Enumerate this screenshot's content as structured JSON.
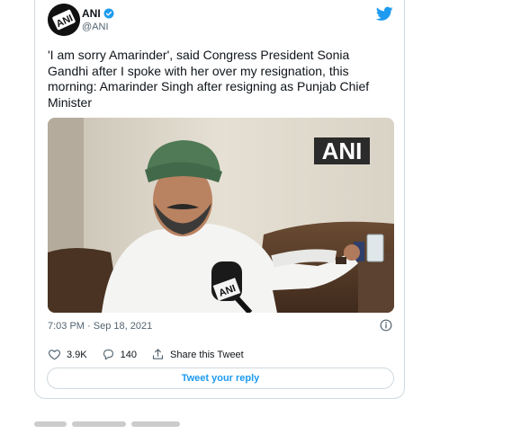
{
  "tweet": {
    "author_name": "ANI",
    "handle": "@ANI",
    "avatar_text": "ANI",
    "text": "'I am sorry Amarinder', said Congress President Sonia Gandhi after I spoke with her over my resignation, this morning: Amarinder Singh after resigning as Punjab Chief Minister",
    "media_watermark": "ANI",
    "mic_logo": "ANI",
    "timestamp": "7:03 PM · Sep 18, 2021",
    "likes": "3.9K",
    "replies": "140",
    "share_label": "Share this Tweet",
    "reply_button_label": "Tweet your reply"
  },
  "colors": {
    "accent": "#1d9bf0",
    "border": "#cfd9de",
    "muted_text": "#536471",
    "dark_text": "#0f1419"
  },
  "icons": [
    "verified-badge-icon",
    "twitter-bird-icon",
    "info-icon",
    "heart-icon",
    "comment-icon",
    "share-icon"
  ]
}
